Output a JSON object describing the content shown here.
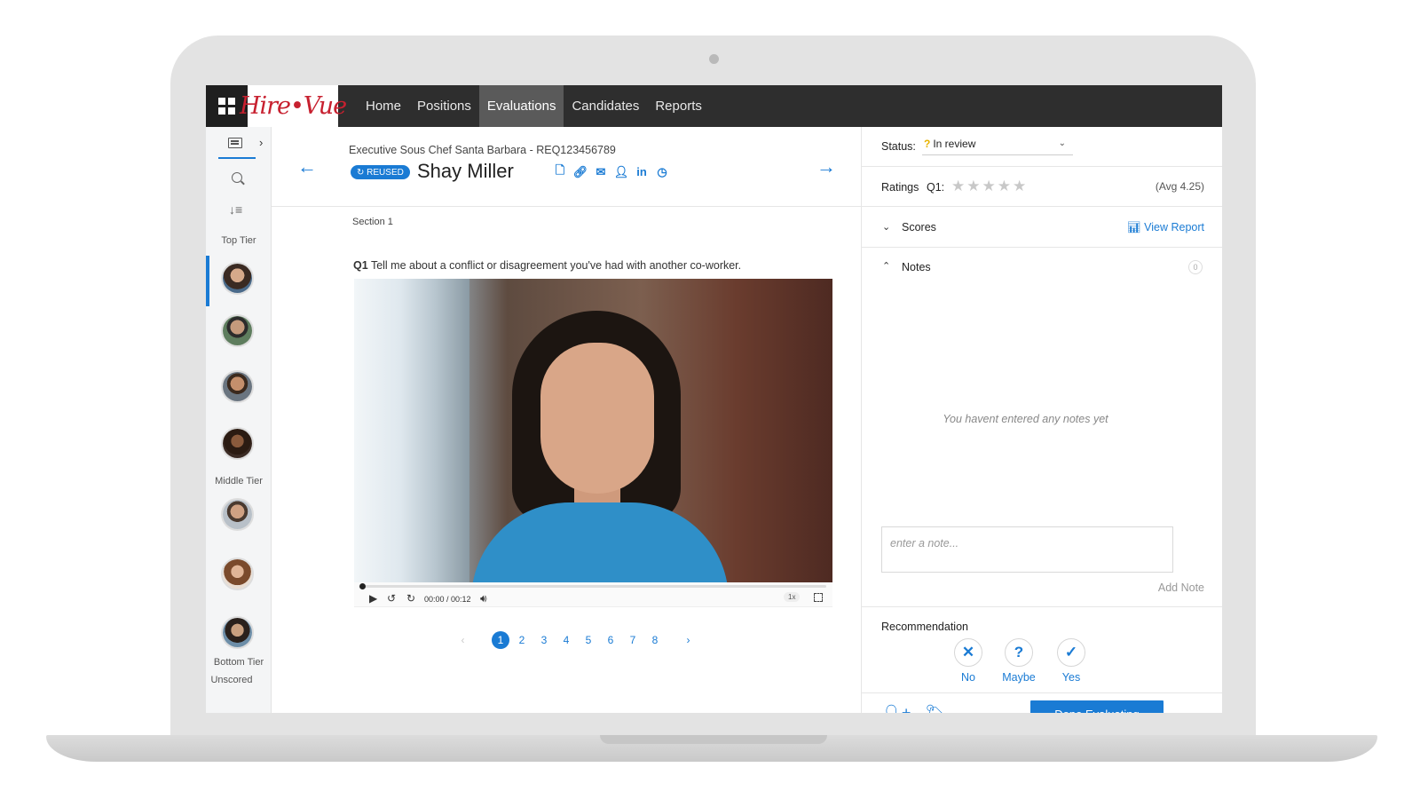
{
  "app": {
    "logo_text": "Hire•Vue",
    "nav": [
      "Home",
      "Positions",
      "Evaluations",
      "Candidates",
      "Reports"
    ],
    "active_nav": "Evaluations",
    "accent_color": "#1a7bd4",
    "brand_color": "#c7202f"
  },
  "sidebar": {
    "top_tier_label": "Top Tier",
    "middle_tier_label": "Middle Tier",
    "bottom_tier_label": "Bottom Tier",
    "unscored_label": "Unscored"
  },
  "header": {
    "requisition": "Executive Sous Chef Santa Barbara - REQ123456789",
    "badge": "↻ REUSED",
    "candidate_name": "Shay Miller",
    "icons": [
      "document-icon",
      "link-icon",
      "email-icon",
      "profile-icon",
      "linkedin-icon",
      "history-icon"
    ]
  },
  "interview": {
    "section": "Section 1",
    "question_num": "Q1",
    "question_text": "Tell me about a conflict or disagreement you've had with another co-worker.",
    "time": "00:00 / 00:12",
    "speed": "1x",
    "progress": 0
  },
  "pagination": {
    "prev": "‹",
    "pages": [
      "1",
      "2",
      "3",
      "4",
      "5",
      "6",
      "7",
      "8"
    ],
    "current": "1",
    "next": "›"
  },
  "panel": {
    "status_label": "Status:",
    "status_icon": "?",
    "status_value": "In review",
    "ratings_label": "Ratings",
    "ratings_q": "Q1:",
    "rating_value": 0,
    "rating_max": 5,
    "avg": "(Avg 4.25)",
    "scores_label": "Scores",
    "view_report": "View Report",
    "notes_label": "Notes",
    "notes_count": "0",
    "no_notes_text": "You havent entered any notes yet",
    "note_placeholder": "enter a note...",
    "add_note": "Add Note",
    "recommendation_label": "Recommendation",
    "rec_no": "No",
    "rec_maybe": "Maybe",
    "rec_yes": "Yes",
    "done_button": "Done Evaluating"
  }
}
